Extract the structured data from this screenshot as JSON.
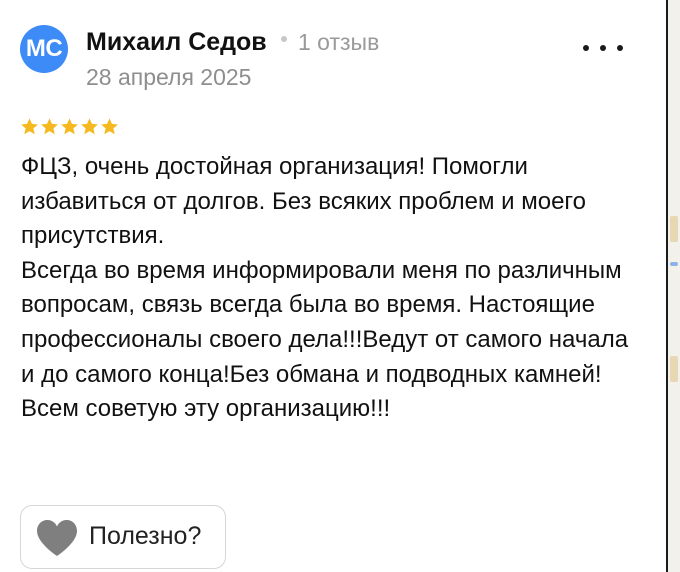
{
  "review": {
    "author": {
      "initials": "МС",
      "name": "Михаил Седов",
      "reviews_count": "1 отзыв",
      "avatar_color": "#3d8bf7"
    },
    "date": "28 апреля 2025",
    "rating": 5,
    "rating_max": 5,
    "star_color": "#f5b81e",
    "text_paragraphs": [
      "ФЦЗ, очень достойная организация! Помогли избавиться от долгов. Без всяких проблем и моего присутствия.",
      "Всегда во время информировали меня по различным вопросам, связь всегда была во время. Настоящие профессионалы своего дела!!!Ведут от самого начала и до самого конца!Без обмана и подводных камней!Всем советую эту организацию!!!"
    ],
    "helpful_label": "Полезно?"
  },
  "icons": {
    "more": "more-dots-icon",
    "star": "star-icon",
    "helpful": "heart-icon"
  }
}
